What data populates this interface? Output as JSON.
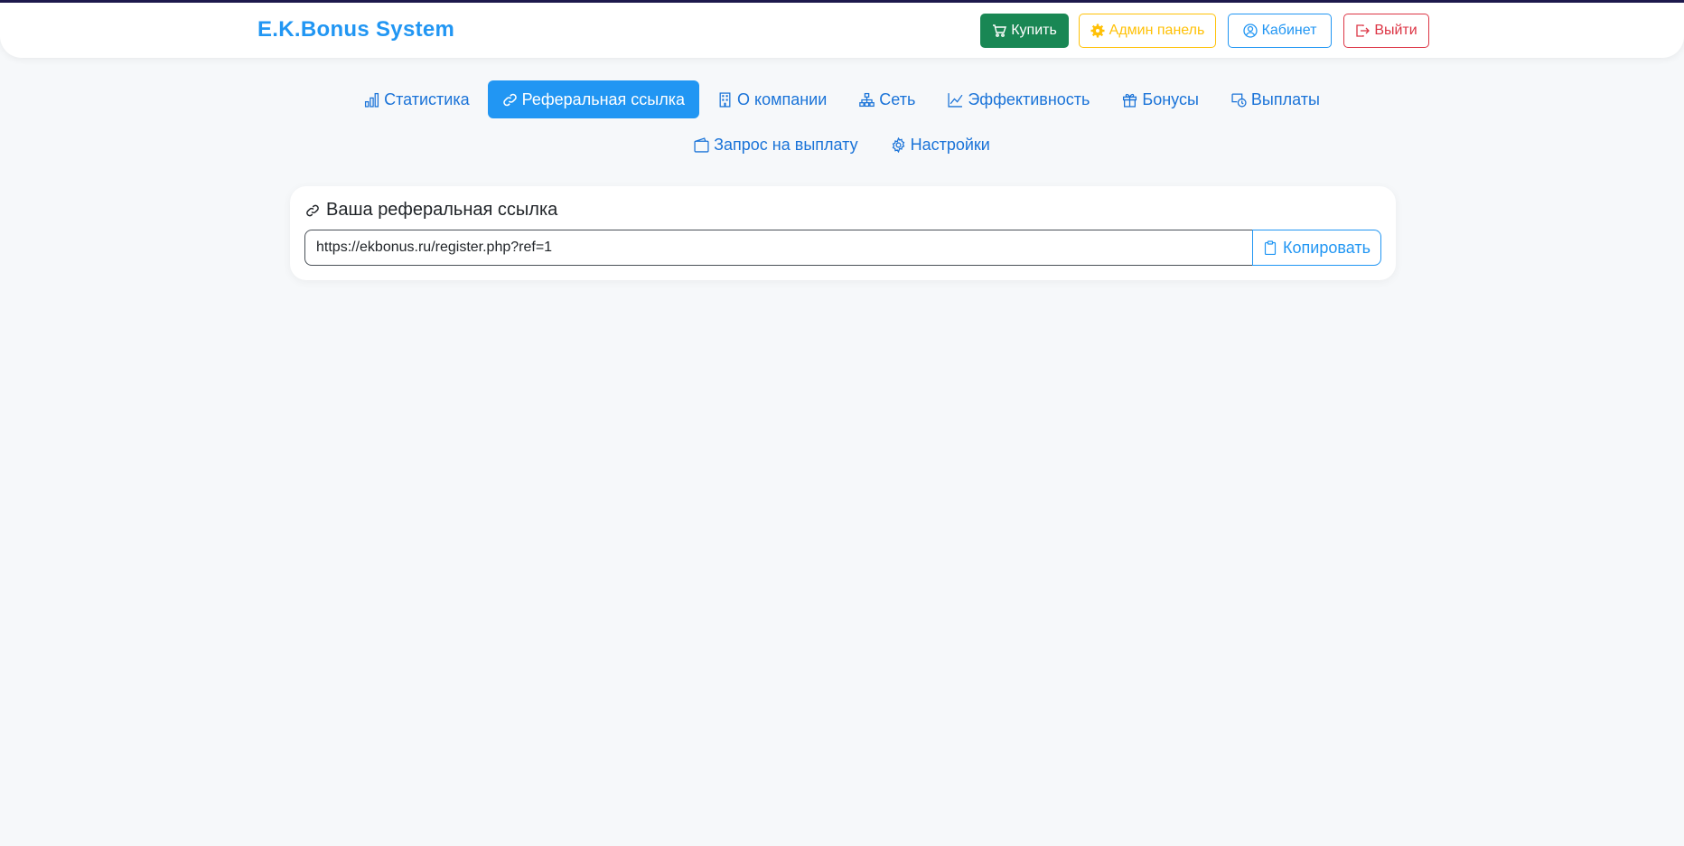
{
  "header": {
    "brand": "E.K.Bonus System",
    "buy_label": "Купить",
    "admin_label": "Админ панель",
    "cabinet_label": "Кабинет",
    "logout_label": "Выйти"
  },
  "tabs": [
    {
      "label": "Статистика",
      "icon": "bar-chart-icon",
      "active": false
    },
    {
      "label": "Реферальная ссылка",
      "icon": "link-icon",
      "active": true
    },
    {
      "label": "О компании",
      "icon": "building-icon",
      "active": false
    },
    {
      "label": "Сеть",
      "icon": "network-icon",
      "active": false
    },
    {
      "label": "Эффективность",
      "icon": "line-chart-icon",
      "active": false
    },
    {
      "label": "Бонусы",
      "icon": "gift-icon",
      "active": false
    },
    {
      "label": "Выплаты",
      "icon": "cash-icon",
      "active": false
    },
    {
      "label": "Запрос на выплату",
      "icon": "wallet-icon",
      "active": false
    },
    {
      "label": "Настройки",
      "icon": "gear-icon",
      "active": false
    }
  ],
  "referral": {
    "title": "Ваша реферальная ссылка",
    "link": "https://ekbonus.ru/register.php?ref=1",
    "copy_label": "Копировать"
  },
  "colors": {
    "primary": "#2196f3",
    "success": "#198754",
    "warning": "#ffc107",
    "danger": "#dc3545",
    "background": "#f6f8fa"
  }
}
